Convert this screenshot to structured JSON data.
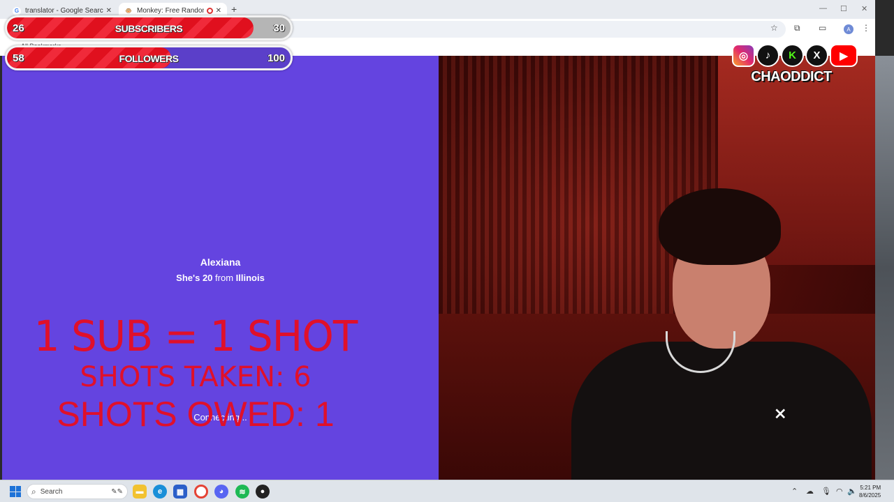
{
  "browser": {
    "tabs": [
      {
        "title": "translator - Google Search",
        "favicon": "G"
      },
      {
        "title": "Monkey: Free Random Vide",
        "favicon": "🐵"
      }
    ],
    "new_tab": "+",
    "avatar_letter": "A",
    "bookmark_label": "All Bookmarks"
  },
  "overlay": {
    "subscribers": {
      "current": "26",
      "label": "SUBSCRIBERS",
      "goal": "30",
      "progress": 0.87
    },
    "followers": {
      "current": "58",
      "label": "FOLLOWERS",
      "goal": "100",
      "progress": 0.58
    },
    "socials": [
      "instagram",
      "tiktok",
      "kick",
      "x",
      "youtube"
    ],
    "handle": "CHAODDICT",
    "shot_rule": "1 SUB = 1 SHOT",
    "shots_taken": "SHOTS TAKEN: 6",
    "shots_owed": "SHOTS OWED: 1"
  },
  "match": {
    "name": "Alexiana",
    "pre_age": "She's ",
    "age": "20",
    "from_word": " from ",
    "location": "Illinois",
    "status": "Connecting..."
  },
  "taskbar": {
    "search_placeholder": "Search",
    "time": "5:21 PM",
    "date": "8/6/2025"
  },
  "colors": {
    "left_pane": "#6444e0",
    "overlay_red": "#e0102a"
  }
}
